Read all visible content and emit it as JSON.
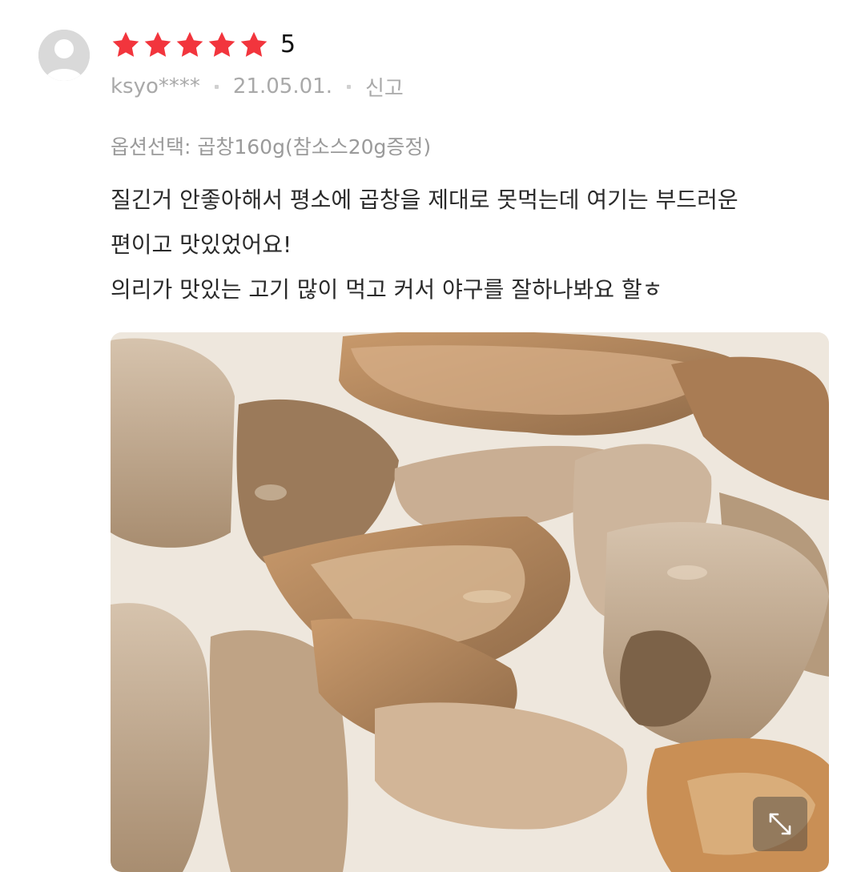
{
  "review": {
    "rating": {
      "stars_filled": 5,
      "stars_total": 5,
      "score_text": "5",
      "star_color": "#f2353d"
    },
    "meta": {
      "username": "ksyo****",
      "date": "21.05.01.",
      "report_label": "신고"
    },
    "option_text": "옵션선택: 곱창160g(참소스20g증정)",
    "body_lines": [
      "질긴거 안좋아해서 평소에 곱창을 제대로 못먹는데 여기는 부드러운",
      "편이고 맛있었어요!",
      "의리가 맛있는 고기 많이 먹고 커서 야구를 잘하나봐요 할ㅎ"
    ],
    "photo": {
      "subject": "grilled beef intestines (gopchang) on paper",
      "expand_icon": "expand-arrows-icon"
    },
    "avatar_icon": "default-user-avatar-icon"
  },
  "colors": {
    "star": "#f2353d",
    "meta_text": "#a9a9a9",
    "body_text": "#2a2a2a"
  }
}
